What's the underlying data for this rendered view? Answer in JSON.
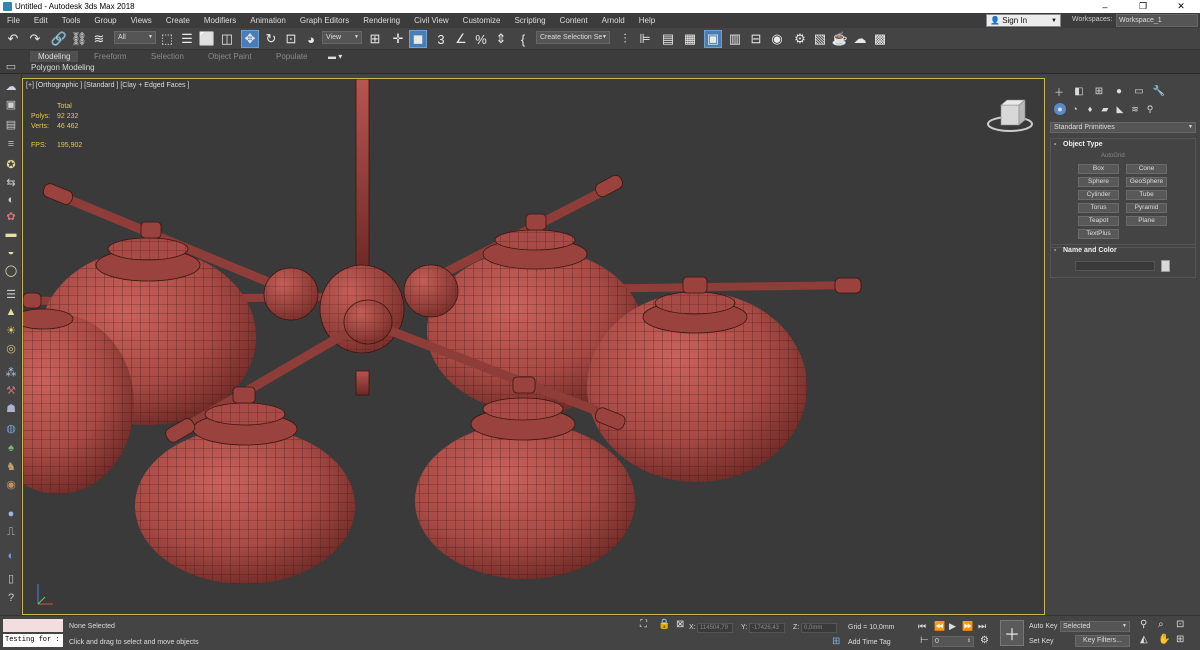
{
  "window": {
    "title": "Untitled - Autodesk 3ds Max 2018",
    "minimize": "–",
    "restore": "❐",
    "close": "✕"
  },
  "menu": {
    "items": [
      "File",
      "Edit",
      "Tools",
      "Group",
      "Views",
      "Create",
      "Modifiers",
      "Animation",
      "Graph Editors",
      "Rendering",
      "Civil View",
      "Customize",
      "Scripting",
      "Content",
      "Arnold",
      "Help"
    ],
    "sign_in": "Sign In",
    "workspaces_label": "Workspaces:",
    "workspace_value": "Workspace_1"
  },
  "toolbar": {
    "selection_filter": "All",
    "ref_coord": "View",
    "named_selection": "Create Selection Se"
  },
  "ribbon": {
    "tabs": [
      "Modeling",
      "Freeform",
      "Selection",
      "Object Paint",
      "Populate"
    ],
    "active_tab": "Modeling",
    "sub_label": "Polygon Modeling"
  },
  "viewport": {
    "label": "[+] [Orthographic ] [Standard ] [Clay + Edged Faces ]",
    "stats": {
      "total_label": "Total",
      "polys_label": "Polys:",
      "polys_value": "92 232",
      "verts_label": "Verts:",
      "verts_value": "46 462",
      "fps_label": "FPS:",
      "fps_value": "195,902"
    }
  },
  "command_panel": {
    "dropdown": "Standard Primitives",
    "object_type_title": "Object Type",
    "autogrid": "AutoGrid",
    "buttons": [
      "Box",
      "Cone",
      "Sphere",
      "GeoSphere",
      "Cylinder",
      "Tube",
      "Torus",
      "Pyramid",
      "Teapot",
      "Plane",
      "TextPlus"
    ],
    "name_color_title": "Name and Color"
  },
  "status": {
    "mini_input": "Testing for :",
    "selection": "None Selected",
    "prompt": "Click and drag to select and move objects",
    "x_label": "X:",
    "x_value": "114504,79",
    "y_label": "Y:",
    "y_value": "-17426,43",
    "z_label": "Z:",
    "z_value": "0,0mm",
    "grid": "Grid = 10,0mm",
    "add_time_tag": "Add Time Tag",
    "frame": "0",
    "auto_key": "Auto Key",
    "set_key": "Set Key",
    "key_mode": "Selected",
    "key_filters": "Key Filters..."
  },
  "colors": {
    "model": "#a84a45",
    "model_wire": "#3a1512",
    "viewport_bg": "#3a3a3a",
    "viewport_border": "#c8b850",
    "stats_text": "#e6c84a",
    "active_tool": "#4a7db5"
  }
}
